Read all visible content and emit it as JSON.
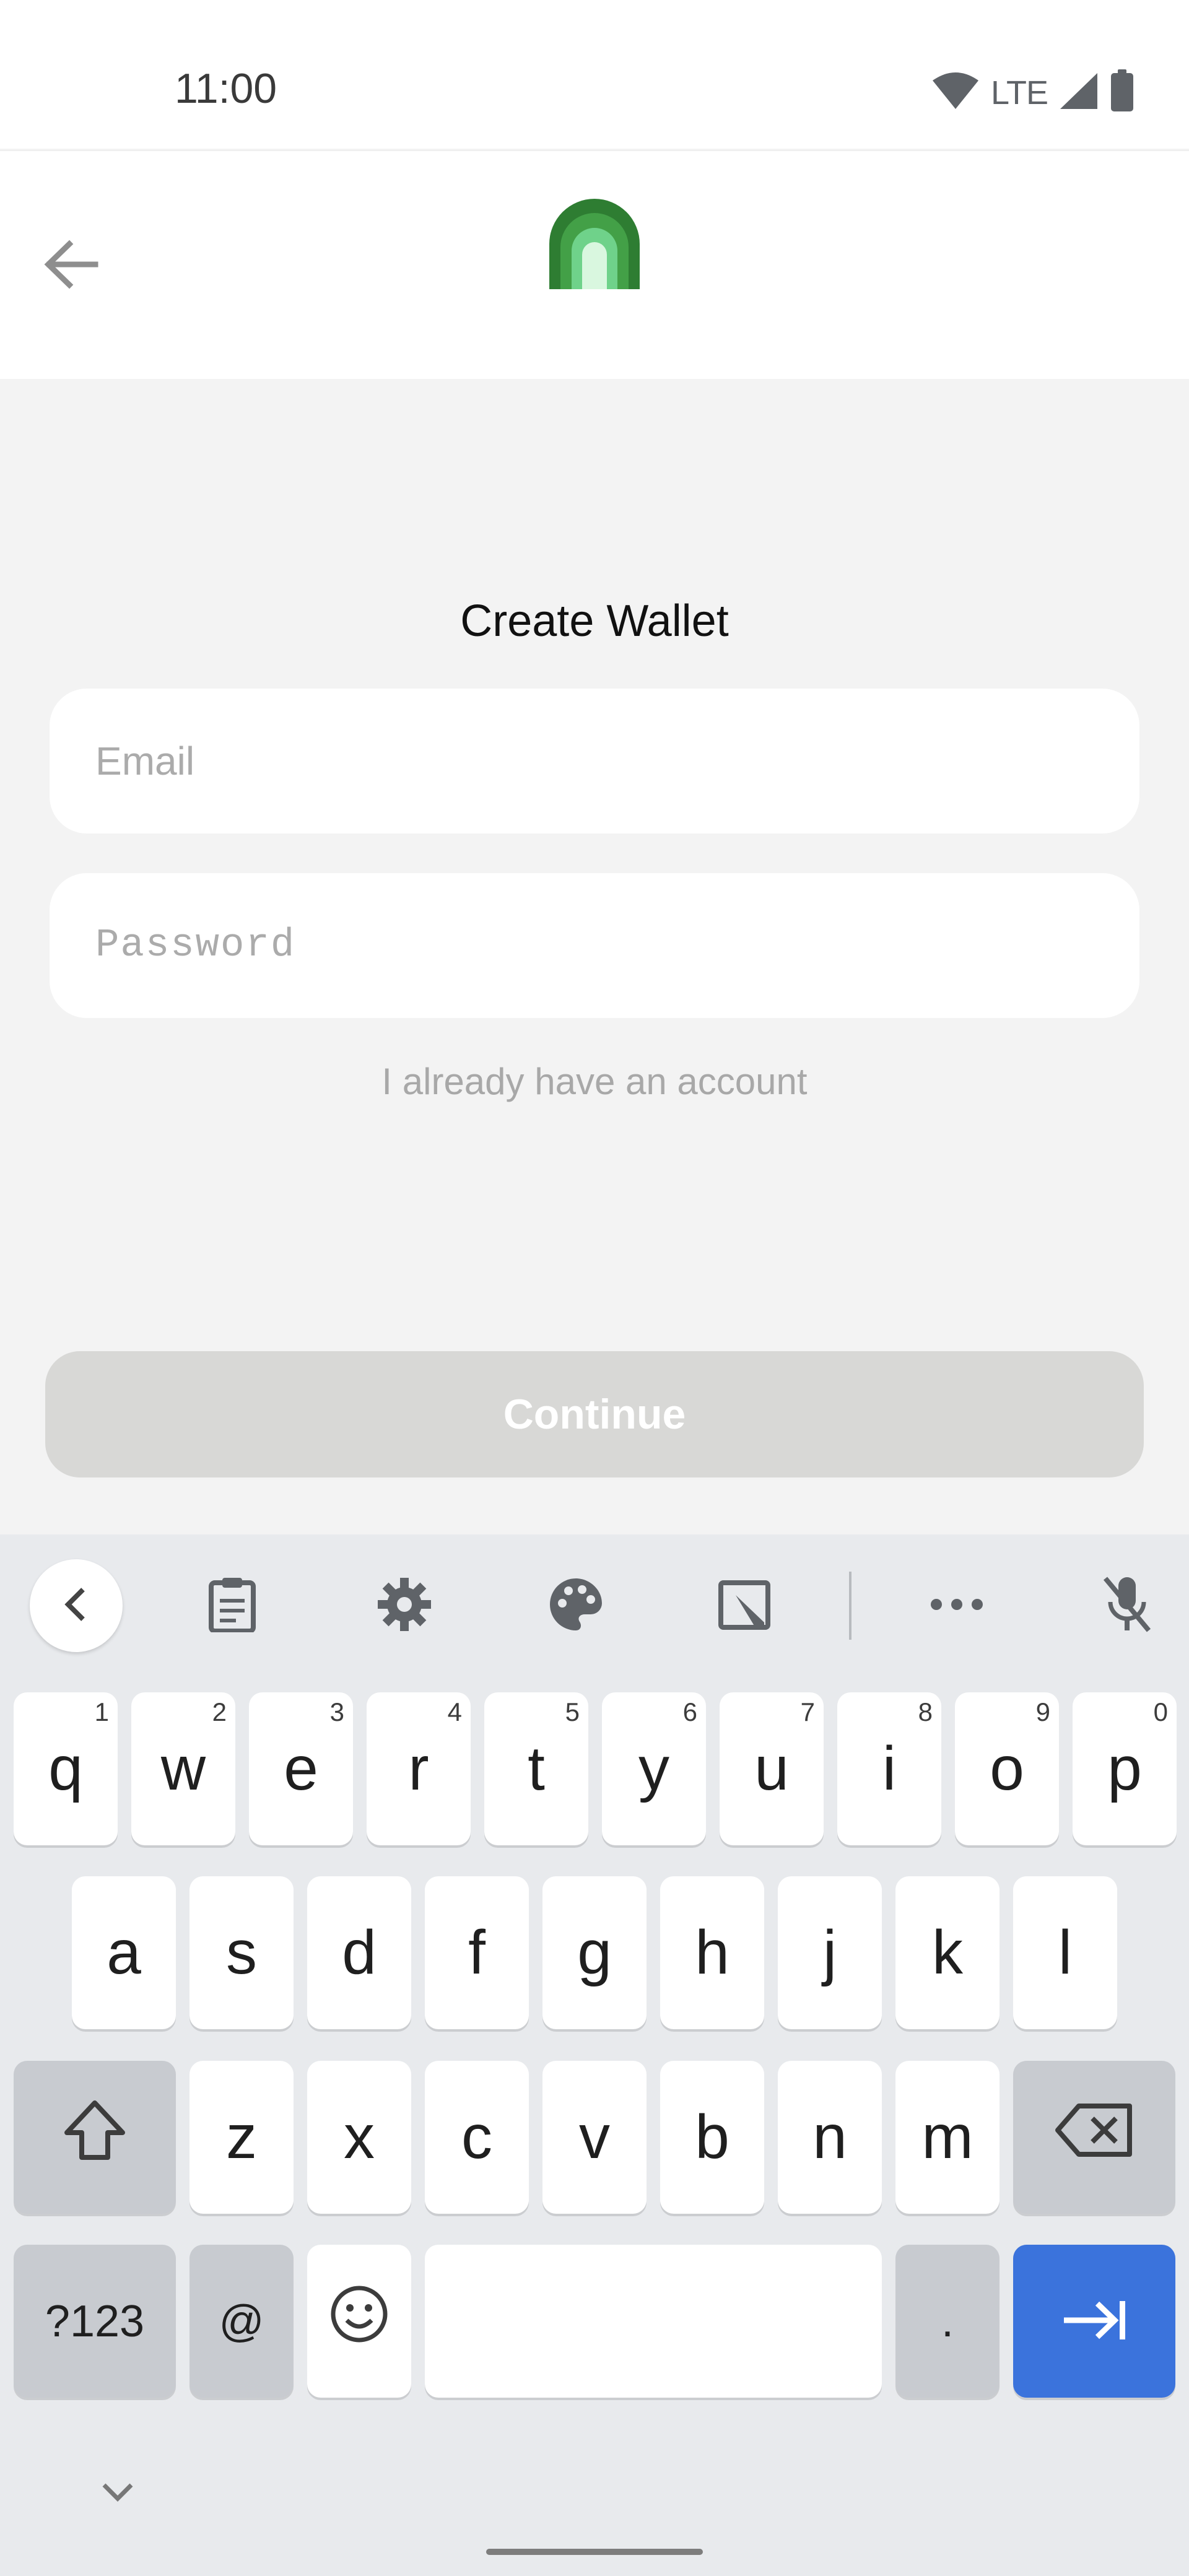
{
  "status_bar": {
    "time": "11:00",
    "network": "LTE",
    "icons": [
      "wifi-icon",
      "cell-signal-icon",
      "battery-icon"
    ]
  },
  "header": {
    "back_icon": "arrow-left-icon",
    "logo": "arch-logo"
  },
  "form": {
    "title": "Create Wallet",
    "email_placeholder": "Email",
    "email_value": "",
    "password_placeholder": "Password",
    "password_value": "",
    "signin_link": "I already have an account",
    "continue_label": "Continue"
  },
  "colors": {
    "background": "#f3f3f3",
    "continue_disabled": "#d8d8d6",
    "logo_dark": "#2e7d32",
    "logo_mid": "#43a047",
    "logo_light": "#9be7a6",
    "enter_key": "#3b73dc"
  },
  "keyboard": {
    "toolbar": [
      "chevron-left-icon",
      "clipboard-icon",
      "gear-icon",
      "palette-icon",
      "edit-icon",
      "more-icon",
      "mic-off-icon"
    ],
    "row1": [
      {
        "key": "q",
        "hint": "1"
      },
      {
        "key": "w",
        "hint": "2"
      },
      {
        "key": "e",
        "hint": "3"
      },
      {
        "key": "r",
        "hint": "4"
      },
      {
        "key": "t",
        "hint": "5"
      },
      {
        "key": "y",
        "hint": "6"
      },
      {
        "key": "u",
        "hint": "7"
      },
      {
        "key": "i",
        "hint": "8"
      },
      {
        "key": "o",
        "hint": "9"
      },
      {
        "key": "p",
        "hint": "0"
      }
    ],
    "row2": [
      "a",
      "s",
      "d",
      "f",
      "g",
      "h",
      "j",
      "k",
      "l"
    ],
    "row3": [
      "z",
      "x",
      "c",
      "v",
      "b",
      "n",
      "m"
    ],
    "row4": {
      "symbols": "?123",
      "at": "@",
      "period": "."
    }
  }
}
